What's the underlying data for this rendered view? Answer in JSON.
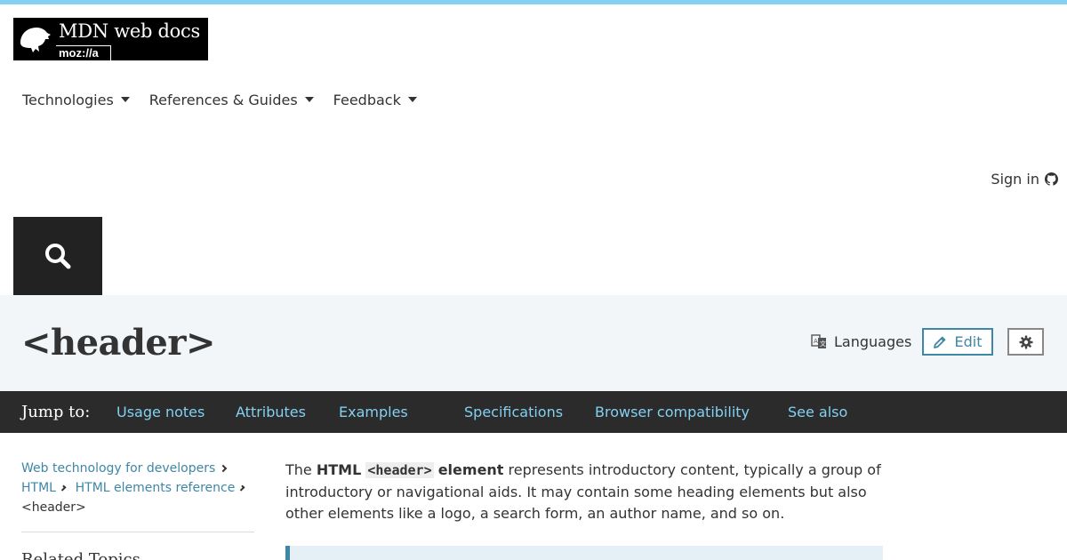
{
  "header": {
    "logo_line1": "MDN web docs",
    "logo_line2": "moz://a",
    "nav": [
      {
        "label": "Technologies"
      },
      {
        "label": "References & Guides"
      },
      {
        "label": "Feedback"
      }
    ],
    "signin_label": "Sign in"
  },
  "titlebar": {
    "title": "<header>",
    "languages_label": "Languages",
    "edit_label": "Edit"
  },
  "jumpbar": {
    "label": "Jump to:",
    "links": [
      "Usage notes",
      "Attributes",
      "Examples",
      "Specifications",
      "Browser compatibility",
      "See also"
    ]
  },
  "sidebar": {
    "breadcrumbs": [
      "Web technology for developers",
      "HTML",
      "HTML elements reference"
    ],
    "current": "<header>",
    "related_title": "Related Topics"
  },
  "article": {
    "intro_pre": "The ",
    "intro_bold1": "HTML",
    "intro_code": "<header>",
    "intro_bold2": "element",
    "intro_post": " represents introductory content, typically a group of introductory or navigational aids. It may contain some heading elements but also other elements like a logo, a search form, an author name, and so on."
  },
  "colors": {
    "topbar": "#83d0f2",
    "link": "#3f87a6",
    "jumpbar_bg": "#2b2b2b",
    "jump_link": "#83d0f2",
    "titlebar_bg": "#f2f6f8"
  }
}
